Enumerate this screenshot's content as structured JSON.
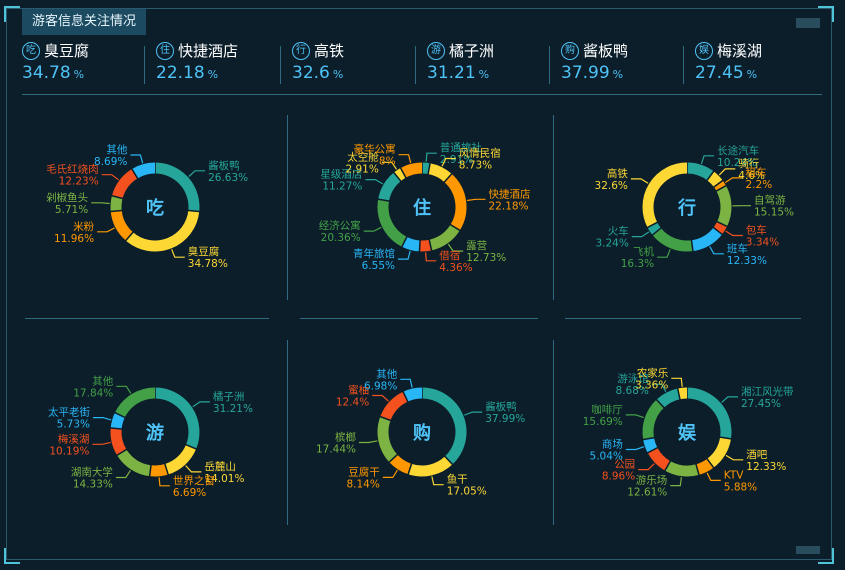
{
  "title": "游客信息关注情况",
  "stats": [
    {
      "icon": "吃",
      "label": "臭豆腐",
      "value": "34.78",
      "unit": "%"
    },
    {
      "icon": "住",
      "label": "快捷酒店",
      "value": "22.18",
      "unit": "%"
    },
    {
      "icon": "行",
      "label": "高铁",
      "value": "32.6",
      "unit": "%"
    },
    {
      "icon": "游",
      "label": "橘子洲",
      "value": "31.21",
      "unit": "%"
    },
    {
      "icon": "购",
      "label": "酱板鸭",
      "value": "37.99",
      "unit": "%"
    },
    {
      "icon": "娱",
      "label": "梅溪湖",
      "value": "27.45",
      "unit": "%"
    }
  ],
  "colors": {
    "teal": "#26a69a",
    "yellow": "#fdd835",
    "orange": "#ff9800",
    "green": "#7cb342",
    "red": "#f4511e",
    "blue": "#29b6f6",
    "darkgreen": "#43a047",
    "darkbg": "#0b1e2a"
  },
  "chart_data": [
    {
      "type": "pie",
      "center_label": "吃",
      "series": [
        {
          "name": "酱板鸭",
          "value": 26.63,
          "color": "#26a69a"
        },
        {
          "name": "臭豆腐",
          "value": 34.78,
          "color": "#fdd835"
        },
        {
          "name": "米粉",
          "value": 11.96,
          "color": "#ff9800"
        },
        {
          "name": "剁椒鱼头",
          "value": 5.71,
          "color": "#7cb342"
        },
        {
          "name": "毛氏红烧肉",
          "value": 12.23,
          "color": "#f4511e"
        },
        {
          "name": "其他",
          "value": 8.69,
          "color": "#29b6f6"
        }
      ]
    },
    {
      "type": "pie",
      "center_label": "住",
      "series": [
        {
          "name": "普通旅社",
          "value": 2.91,
          "color": "#26a69a"
        },
        {
          "name": "风情民宿",
          "value": 8.73,
          "color": "#fdd835"
        },
        {
          "name": "快捷酒店",
          "value": 22.18,
          "color": "#ff9800"
        },
        {
          "name": "露营",
          "value": 12.73,
          "color": "#7cb342"
        },
        {
          "name": "借宿",
          "value": 4.36,
          "color": "#f4511e"
        },
        {
          "name": "青年旅馆",
          "value": 6.55,
          "color": "#29b6f6"
        },
        {
          "name": "经济公寓",
          "value": 20.36,
          "color": "#43a047"
        },
        {
          "name": "星级酒店",
          "value": 11.27,
          "color": "#26a69a"
        },
        {
          "name": "太空舱",
          "value": 2.91,
          "color": "#fdd835"
        },
        {
          "name": "豪华公寓",
          "value": 8,
          "color": "#ff9800"
        }
      ]
    },
    {
      "type": "pie",
      "center_label": "行",
      "series": [
        {
          "name": "长途汽车",
          "value": 10.24,
          "color": "#26a69a"
        },
        {
          "name": "骑行",
          "value": 4.6,
          "color": "#fdd835"
        },
        {
          "name": "租车",
          "value": 2.2,
          "color": "#ff9800"
        },
        {
          "name": "自驾游",
          "value": 15.15,
          "color": "#7cb342"
        },
        {
          "name": "包车",
          "value": 3.34,
          "color": "#f4511e"
        },
        {
          "name": "班车",
          "value": 12.33,
          "color": "#29b6f6"
        },
        {
          "name": "飞机",
          "value": 16.3,
          "color": "#43a047"
        },
        {
          "name": "火车",
          "value": 3.24,
          "color": "#26a69a"
        },
        {
          "name": "高铁",
          "value": 32.6,
          "color": "#fdd835"
        }
      ]
    },
    {
      "type": "pie",
      "center_label": "游",
      "series": [
        {
          "name": "橘子洲",
          "value": 31.21,
          "color": "#26a69a"
        },
        {
          "name": "岳麓山",
          "value": 14.01,
          "color": "#fdd835"
        },
        {
          "name": "世界之窗",
          "value": 6.69,
          "color": "#ff9800"
        },
        {
          "name": "湖南大学",
          "value": 14.33,
          "color": "#7cb342"
        },
        {
          "name": "梅溪湖",
          "value": 10.19,
          "color": "#f4511e"
        },
        {
          "name": "太平老街",
          "value": 5.73,
          "color": "#29b6f6"
        },
        {
          "name": "其他",
          "value": 17.84,
          "color": "#43a047"
        }
      ]
    },
    {
      "type": "pie",
      "center_label": "购",
      "series": [
        {
          "name": "酱板鸭",
          "value": 37.99,
          "color": "#26a69a"
        },
        {
          "name": "鱼干",
          "value": 17.05,
          "color": "#fdd835"
        },
        {
          "name": "豆腐干",
          "value": 8.14,
          "color": "#ff9800"
        },
        {
          "name": "槟榔",
          "value": 17.44,
          "color": "#7cb342"
        },
        {
          "name": "蜜柚",
          "value": 12.4,
          "color": "#f4511e"
        },
        {
          "name": "其他",
          "value": 6.98,
          "color": "#29b6f6"
        }
      ]
    },
    {
      "type": "pie",
      "center_label": "娱",
      "series": [
        {
          "name": "湘江风光带",
          "value": 27.45,
          "color": "#26a69a"
        },
        {
          "name": "酒吧",
          "value": 12.33,
          "color": "#fdd835"
        },
        {
          "name": "KTV",
          "value": 5.88,
          "color": "#ff9800"
        },
        {
          "name": "游乐场",
          "value": 12.61,
          "color": "#7cb342"
        },
        {
          "name": "公园",
          "value": 8.96,
          "color": "#f4511e"
        },
        {
          "name": "商场",
          "value": 5.04,
          "color": "#29b6f6"
        },
        {
          "name": "咖啡厅",
          "value": 15.69,
          "color": "#43a047"
        },
        {
          "name": "游泳馆",
          "value": 8.68,
          "color": "#26a69a"
        },
        {
          "name": "农家乐",
          "value": 3.36,
          "color": "#fdd835"
        }
      ]
    }
  ]
}
